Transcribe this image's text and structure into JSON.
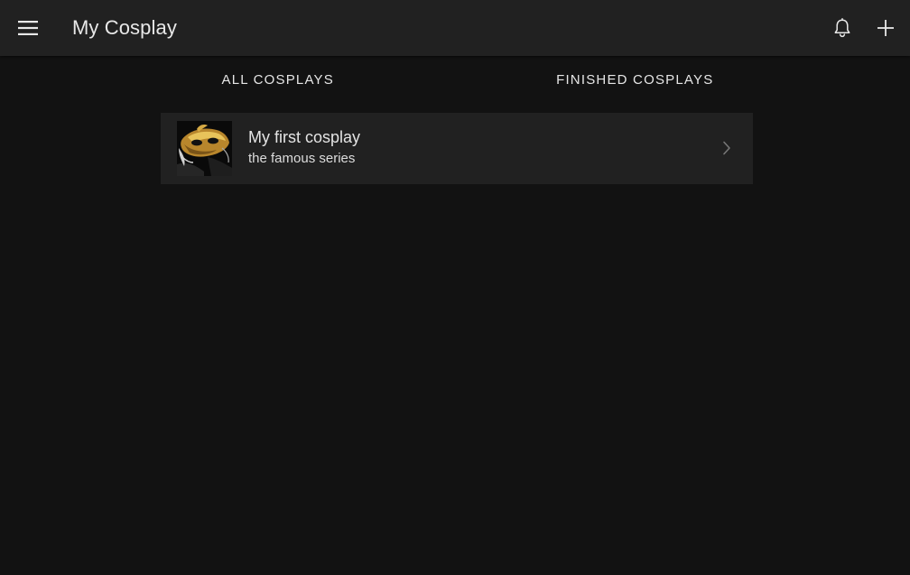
{
  "toolbar": {
    "title": "My Cosplay",
    "menu_icon": "menu-icon",
    "notification_icon": "bell-icon",
    "add_icon": "plus-icon"
  },
  "tabs": [
    {
      "label": "ALL COSPLAYS"
    },
    {
      "label": "FINISHED COSPLAYS"
    }
  ],
  "cosplays": [
    {
      "title": "My first cosplay",
      "series": "the famous series",
      "thumbnail_icon": "mask-image",
      "chevron_icon": "chevron-right-icon"
    }
  ],
  "colors": {
    "background": "#121212",
    "toolbar": "#212121",
    "card": "#212121",
    "text": "#e6e6e6"
  }
}
